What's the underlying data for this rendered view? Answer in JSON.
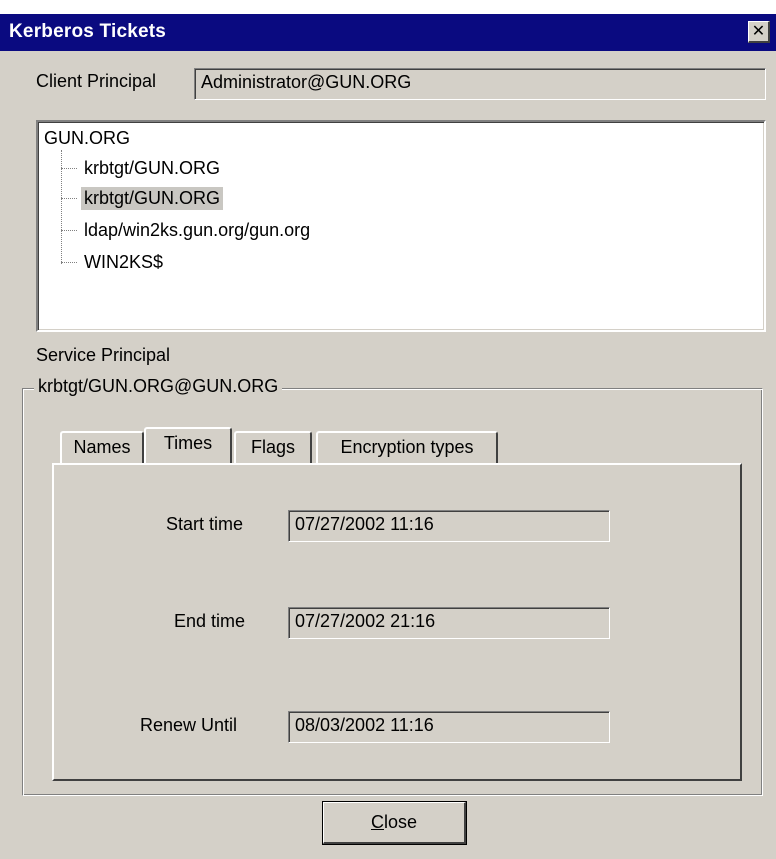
{
  "window": {
    "title": "Kerberos Tickets",
    "close_glyph": "✕"
  },
  "client": {
    "label": "Client Principal",
    "value": "Administrator@GUN.ORG"
  },
  "tree": {
    "root": "GUN.ORG",
    "items": [
      {
        "label": "krbtgt/GUN.ORG",
        "selected": false
      },
      {
        "label": "krbtgt/GUN.ORG",
        "selected": true
      },
      {
        "label": "ldap/win2ks.gun.org/gun.org",
        "selected": false
      },
      {
        "label": "WIN2KS$",
        "selected": false
      }
    ]
  },
  "service": {
    "label": "Service Principal",
    "group_title": "krbtgt/GUN.ORG@GUN.ORG"
  },
  "tabs": [
    {
      "label": "Names",
      "active": false
    },
    {
      "label": "Times",
      "active": true
    },
    {
      "label": "Flags",
      "active": false
    },
    {
      "label": "Encryption types",
      "active": false
    }
  ],
  "times": {
    "start": {
      "label": "Start time",
      "value": "07/27/2002 11:16"
    },
    "end": {
      "label": "End time",
      "value": "07/27/2002 21:16"
    },
    "renew": {
      "label": "Renew Until",
      "value": "08/03/2002 11:16"
    }
  },
  "buttons": {
    "close_mnemonic": "C",
    "close_rest": "lose"
  },
  "colors": {
    "title_bar": "#0a0a80",
    "dialog_face": "#d4d0c8",
    "selection": "#c9c7c2"
  }
}
